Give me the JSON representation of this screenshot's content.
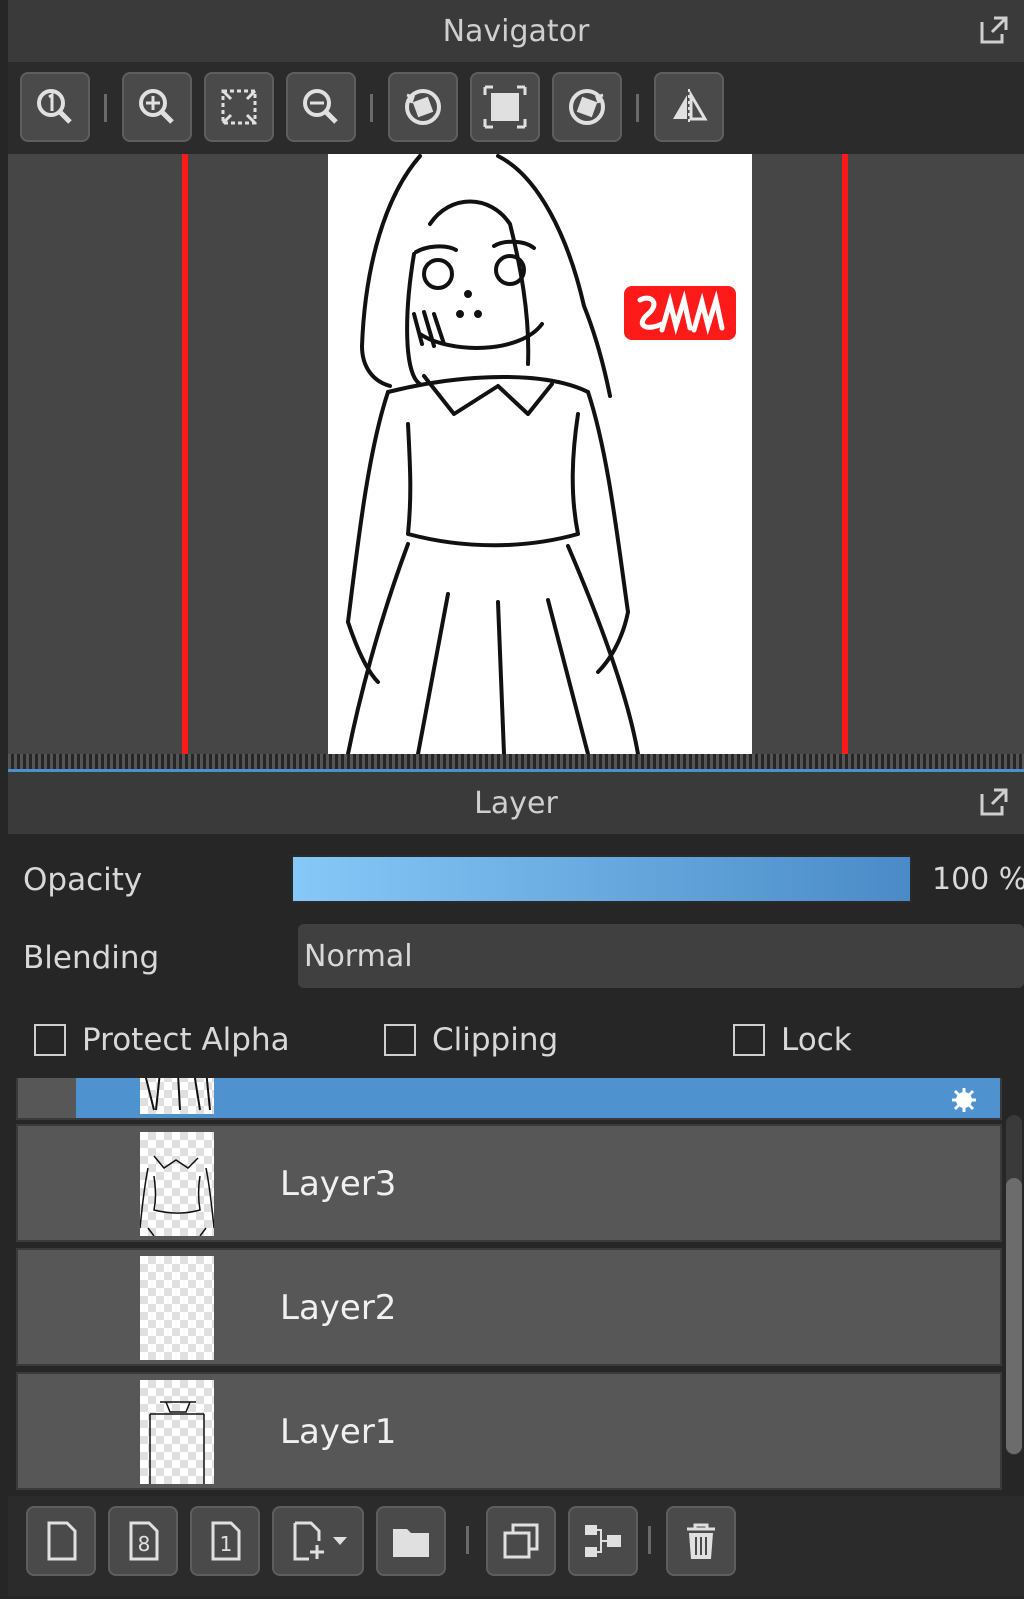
{
  "navigator": {
    "title": "Navigator",
    "toolbar": [
      "zoom-actual-size",
      "zoom-in",
      "zoom-fit",
      "zoom-out",
      "rotate-left",
      "rotate-reset",
      "rotate-right",
      "flip-horizontal"
    ]
  },
  "layer_panel": {
    "title": "Layer",
    "opacity_label": "Opacity",
    "opacity_value": "100 %",
    "opacity_fraction": 1.0,
    "blending_label": "Blending",
    "blending_value": "Normal",
    "checkboxes": {
      "protect_alpha": "Protect Alpha",
      "clipping": "Clipping",
      "lock": "Lock"
    },
    "layers": [
      "Layer3",
      "Layer2",
      "Layer1"
    ]
  },
  "colors": {
    "accent": "#4e92cf",
    "frame_line": "#ff1a1a",
    "panel": "#3a3a3a",
    "background": "#262626"
  }
}
